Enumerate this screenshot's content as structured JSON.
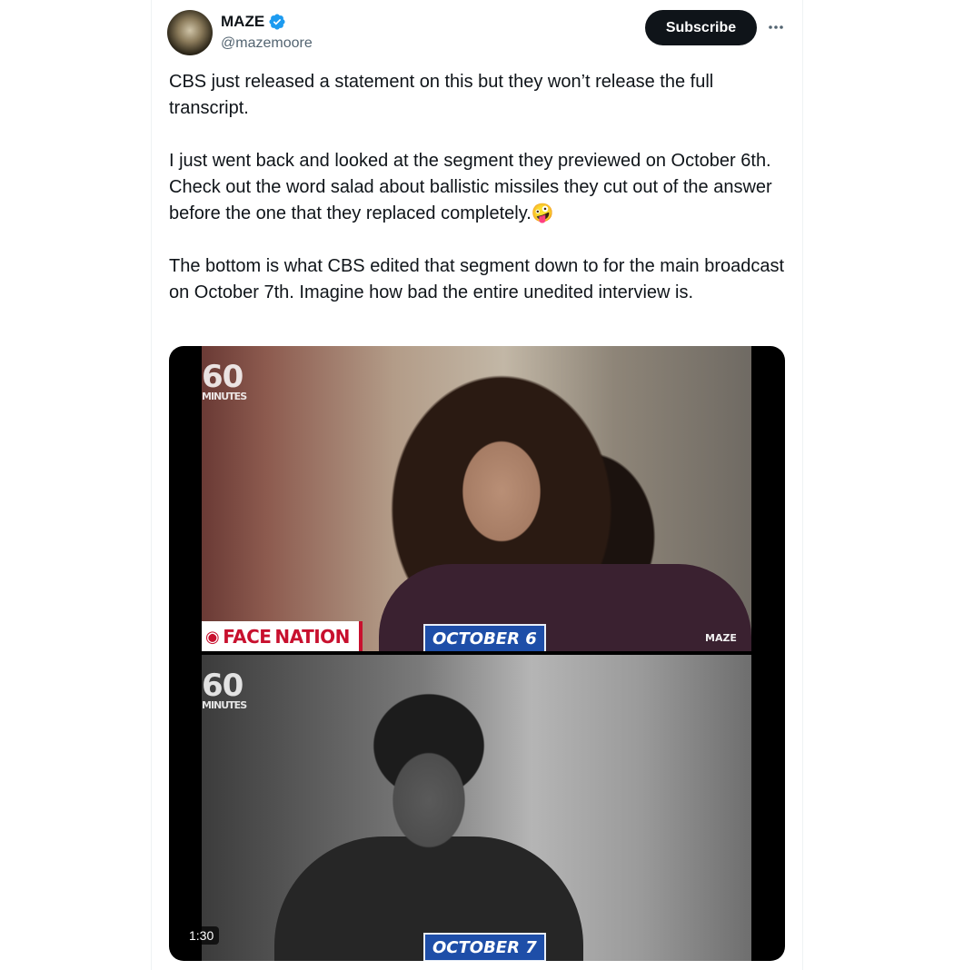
{
  "author": {
    "display_name": "MAZE",
    "handle": "@mazemoore",
    "verified": true,
    "avatar_icon": "avatar-icon"
  },
  "actions": {
    "subscribe_label": "Subscribe",
    "more_icon": "more-icon"
  },
  "tweet": {
    "paragraphs": [
      "CBS just released a statement on this but they won’t release the full transcript.",
      "I just went back and looked at the segment they previewed on October 6th. Check out the word salad about ballistic missiles they cut out of the answer before the one that they replaced completely.🤪",
      "The bottom is what CBS edited that segment down to for the main broadcast on October 7th. Imagine how bad the entire unedited interview is."
    ]
  },
  "media": {
    "duration": "1:30",
    "top_panel": {
      "logo_number": "60",
      "logo_word": "MINUTES",
      "program": "FACE",
      "program_suffix": "NATION",
      "date_label": "OCTOBER 6",
      "watermark": "MAZE"
    },
    "bottom_panel": {
      "logo_number": "60",
      "logo_word": "MINUTES",
      "date_label": "OCTOBER 7"
    }
  },
  "colors": {
    "text_primary": "#0f1419",
    "text_secondary": "#536471",
    "verified_blue": "#1d9bf0",
    "button_bg": "#0f1419",
    "badge_blue": "#1e4ea8",
    "cbs_red": "#c8102e"
  }
}
